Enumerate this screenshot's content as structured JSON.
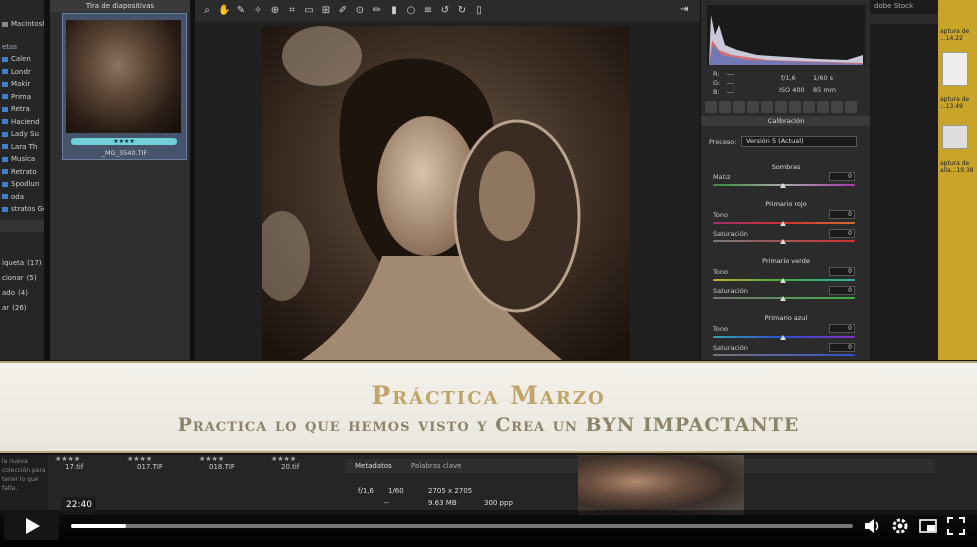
{
  "left_sidebar": {
    "header": "Macintosh",
    "section": "etas",
    "folders": [
      "Calen",
      "Londr",
      "Makir",
      "Prima",
      "Retra",
      "Haciend",
      "Lady Su",
      "Lara Th",
      "Musica",
      "Retrato",
      "Spodlun",
      "oda",
      "stratos Ge..."
    ],
    "keywords": [
      {
        "label": "iqueta",
        "count": "(17)"
      },
      {
        "label": "cionar",
        "count": "(5)"
      },
      {
        "label": "ado",
        "count": "(4)"
      },
      {
        "label": "ar",
        "count": "(26)"
      }
    ]
  },
  "filmstrip": {
    "title": "Tira de diapositivas",
    "thumb_filename": "_MG_3540.TIF",
    "thumb_rating": "★★★★"
  },
  "toolbar": {
    "icons": [
      "zoom-icon",
      "hand-icon",
      "eyedropper-icon",
      "color-sampler-icon",
      "target-adjust-icon",
      "crop-icon",
      "straighten-icon",
      "transform-icon",
      "spot-removal-icon",
      "red-eye-icon",
      "adjustment-brush-icon",
      "graduated-filter-icon",
      "radial-filter-icon",
      "list-icon",
      "rotate-ccw-icon",
      "rotate-cw-icon",
      "trash-icon"
    ]
  },
  "right_panel": {
    "rgb_labels": [
      "R:",
      "G:",
      "B:"
    ],
    "rgb_values": [
      "---",
      "---",
      "---"
    ],
    "exif": {
      "aperture": "f/1,6",
      "shutter": "1/60 s",
      "iso": "ISO 400",
      "focal": "85 mm"
    },
    "section_title": "Calibración",
    "process_label": "Proceso:",
    "process_value": "Versión 5 (Actual)",
    "shadows_title": "Sombras",
    "tint_label": "Matiz",
    "tint_value": "0",
    "red_title": "Primario rojo",
    "green_title": "Primario verde",
    "blue_title": "Primario azul",
    "hue_label": "Tono",
    "sat_label": "Saturación",
    "zero": "0"
  },
  "far_panel": {
    "stock_label": "dobe Stock"
  },
  "desktop_files": [
    "aptura de ...14.22",
    "aptura de ...13.49",
    "aptura de alla...19.38"
  ],
  "banner": {
    "title": "Práctica Marzo",
    "subtitle": "Practica lo que hemos visto y Crea un BYN IMPACTANTE"
  },
  "lower": {
    "side_text": "la nueva colección para tener lo que falta.",
    "files": [
      {
        "stars": "★★★★",
        "name": "17.tif"
      },
      {
        "stars": "★★★★",
        "name": "017.TIF"
      },
      {
        "stars": "★★★★",
        "name": "018.TIF"
      },
      {
        "stars": "★★★★",
        "name": "20.tif"
      }
    ],
    "tab_metadata": "Metadatos",
    "tab_keywords": "Palabras clave",
    "meta_aperture": "f/1,6",
    "meta_shutter": "1/60",
    "meta_size": "2705 x 2705",
    "meta_dash": "--",
    "meta_mb": "9.63 MB",
    "meta_ppp": "300 ppp"
  },
  "video": {
    "time_tooltip": "22:40",
    "progress": 0.07
  }
}
